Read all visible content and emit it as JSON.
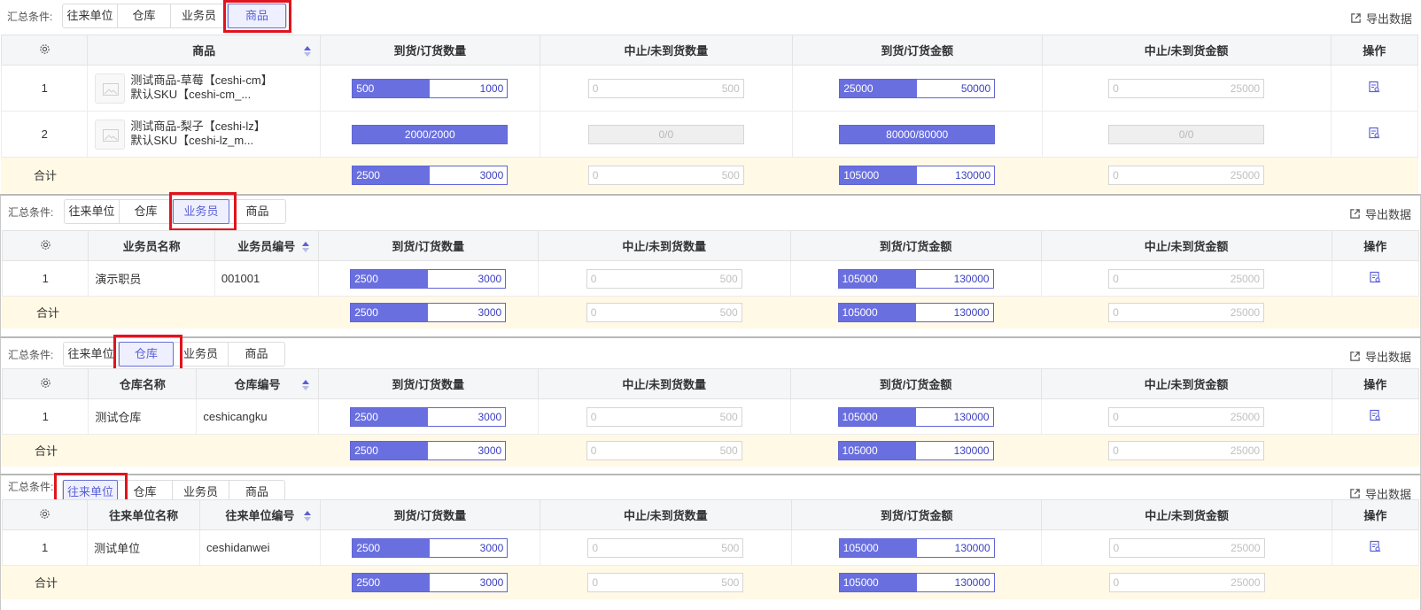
{
  "colors": {
    "accent": "#5a5fd6",
    "bar_fill": "#6a6fe0",
    "highlight": "#e0141e",
    "total_bg": "#fff9e6"
  },
  "labels": {
    "summary": "汇总条件:",
    "export": "导出数据",
    "total": "合计",
    "operate": "操作"
  },
  "tabs": [
    "往来单位",
    "仓库",
    "业务员",
    "商品"
  ],
  "headers": {
    "product": "商品",
    "qty": "到货/订货数量",
    "stop_qty": "中止/未到货数量",
    "amount": "到货/订货金额",
    "stop_amount": "中止/未到货金额",
    "salesman_name": "业务员名称",
    "salesman_code": "业务员编号",
    "warehouse_name": "仓库名称",
    "warehouse_code": "仓库编号",
    "partner_name": "往来单位名称",
    "partner_code": "往来单位编号"
  },
  "panels": {
    "product": {
      "active_tab": "商品",
      "rows": [
        {
          "index": "1",
          "name": "测试商品-草莓【ceshi-cm】",
          "sku": "默认SKU【ceshi-cm_...",
          "qty": [
            "500",
            "1000"
          ],
          "qty_ratio": 0.5,
          "stop_qty": [
            "0",
            "500"
          ],
          "amount": [
            "25000",
            "50000"
          ],
          "amount_ratio": 0.5,
          "stop_amount": [
            "0",
            "25000"
          ]
        },
        {
          "index": "2",
          "name": "测试商品-梨子【ceshi-lz】",
          "sku": "默认SKU【ceshi-lz_m...",
          "qty_full": "2000/2000",
          "stop_qty_full": "0/0",
          "amount_full": "80000/80000",
          "stop_amount_full": "0/0"
        }
      ],
      "total": {
        "qty": [
          "2500",
          "3000"
        ],
        "stop_qty": [
          "0",
          "500"
        ],
        "amount": [
          "105000",
          "130000"
        ],
        "stop_amount": [
          "0",
          "25000"
        ]
      }
    },
    "salesman": {
      "active_tab": "业务员",
      "row": {
        "index": "1",
        "name": "演示职员",
        "code": "001001",
        "qty": [
          "2500",
          "3000"
        ],
        "stop_qty": [
          "0",
          "500"
        ],
        "amount": [
          "105000",
          "130000"
        ],
        "stop_amount": [
          "0",
          "25000"
        ]
      },
      "total": {
        "qty": [
          "2500",
          "3000"
        ],
        "stop_qty": [
          "0",
          "500"
        ],
        "amount": [
          "105000",
          "130000"
        ],
        "stop_amount": [
          "0",
          "25000"
        ]
      }
    },
    "warehouse": {
      "active_tab": "仓库",
      "row": {
        "index": "1",
        "name": "测试仓库",
        "code": "ceshicangku",
        "qty": [
          "2500",
          "3000"
        ],
        "stop_qty": [
          "0",
          "500"
        ],
        "amount": [
          "105000",
          "130000"
        ],
        "stop_amount": [
          "0",
          "25000"
        ]
      },
      "total": {
        "qty": [
          "2500",
          "3000"
        ],
        "stop_qty": [
          "0",
          "500"
        ],
        "amount": [
          "105000",
          "130000"
        ],
        "stop_amount": [
          "0",
          "25000"
        ]
      }
    },
    "partner": {
      "active_tab": "往来单位",
      "row": {
        "index": "1",
        "name": "测试单位",
        "code": "ceshidanwei",
        "qty": [
          "2500",
          "3000"
        ],
        "stop_qty": [
          "0",
          "500"
        ],
        "amount": [
          "105000",
          "130000"
        ],
        "stop_amount": [
          "0",
          "25000"
        ]
      },
      "total": {
        "qty": [
          "2500",
          "3000"
        ],
        "stop_qty": [
          "0",
          "500"
        ],
        "amount": [
          "105000",
          "130000"
        ],
        "stop_amount": [
          "0",
          "25000"
        ]
      }
    }
  },
  "progress_ratio_other": 0.5,
  "icons": {
    "settings": "gear-icon",
    "export": "export-icon",
    "detail": "detail-icon",
    "image": "image-placeholder-icon"
  }
}
